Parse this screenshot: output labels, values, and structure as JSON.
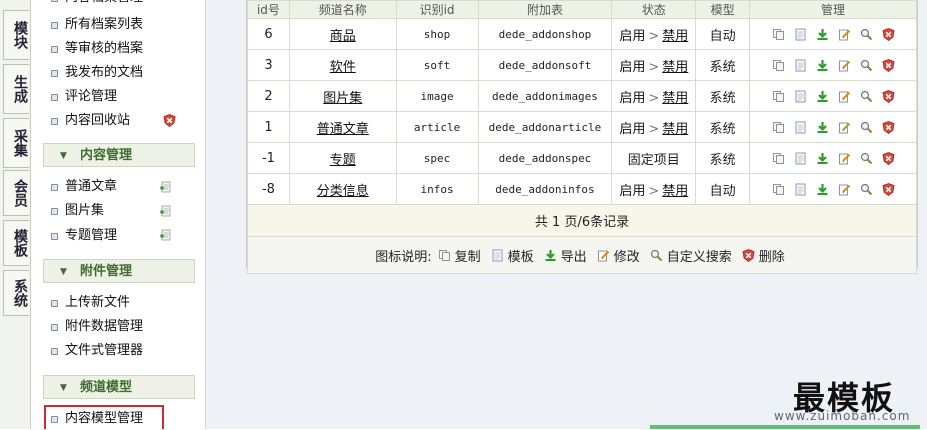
{
  "left_tabs": [
    "模块",
    "生成",
    "采集",
    "会员",
    "模板",
    "系统"
  ],
  "sidebar": {
    "top_partial": "内容档案管理",
    "archive_items": [
      {
        "label": "所有档案列表"
      },
      {
        "label": "等审核的档案"
      },
      {
        "label": "我发布的文档"
      },
      {
        "label": "评论管理"
      },
      {
        "label": "内容回收站"
      }
    ],
    "groups": [
      {
        "title": "内容管理",
        "items": [
          {
            "label": "普通文章"
          },
          {
            "label": "图片集"
          },
          {
            "label": "专题管理"
          }
        ]
      },
      {
        "title": "附件管理",
        "items": [
          {
            "label": "上传新文件"
          },
          {
            "label": "附件数据管理"
          },
          {
            "label": "文件式管理器"
          }
        ]
      },
      {
        "title": "频道模型",
        "items": [
          {
            "label": "内容模型管理"
          }
        ]
      }
    ]
  },
  "table": {
    "headers": [
      "id号",
      "频道名称",
      "识别id",
      "附加表",
      "状态",
      "模型",
      "管理"
    ],
    "rows": [
      {
        "id": "6",
        "name": "商品",
        "nid": "shop",
        "table": "dede_addonshop",
        "status": "启用",
        "disable": "禁用",
        "model": "自动"
      },
      {
        "id": "3",
        "name": "软件",
        "nid": "soft",
        "table": "dede_addonsoft",
        "status": "启用",
        "disable": "禁用",
        "model": "系统"
      },
      {
        "id": "2",
        "name": "图片集",
        "nid": "image",
        "table": "dede_addonimages",
        "status": "启用",
        "disable": "禁用",
        "model": "系统"
      },
      {
        "id": "1",
        "name": "普通文章",
        "nid": "article",
        "table": "dede_addonarticle",
        "status": "启用",
        "disable": "禁用",
        "model": "系统"
      },
      {
        "id": "-1",
        "name": "专题",
        "nid": "spec",
        "table": "dede_addonspec",
        "status": "固定项目",
        "disable": "",
        "model": "系统"
      },
      {
        "id": "-8",
        "name": "分类信息",
        "nid": "infos",
        "table": "dede_addoninfos",
        "status": "启用",
        "disable": "禁用",
        "model": "自动"
      }
    ],
    "pager": "共 1 页/6条记录",
    "legend": {
      "title": "图标说明:",
      "items": [
        "复制",
        "模板",
        "导出",
        "修改",
        "自定义搜索",
        "删除"
      ]
    }
  },
  "watermark": {
    "title": "最模板",
    "url": "www.zuimoban.com"
  }
}
